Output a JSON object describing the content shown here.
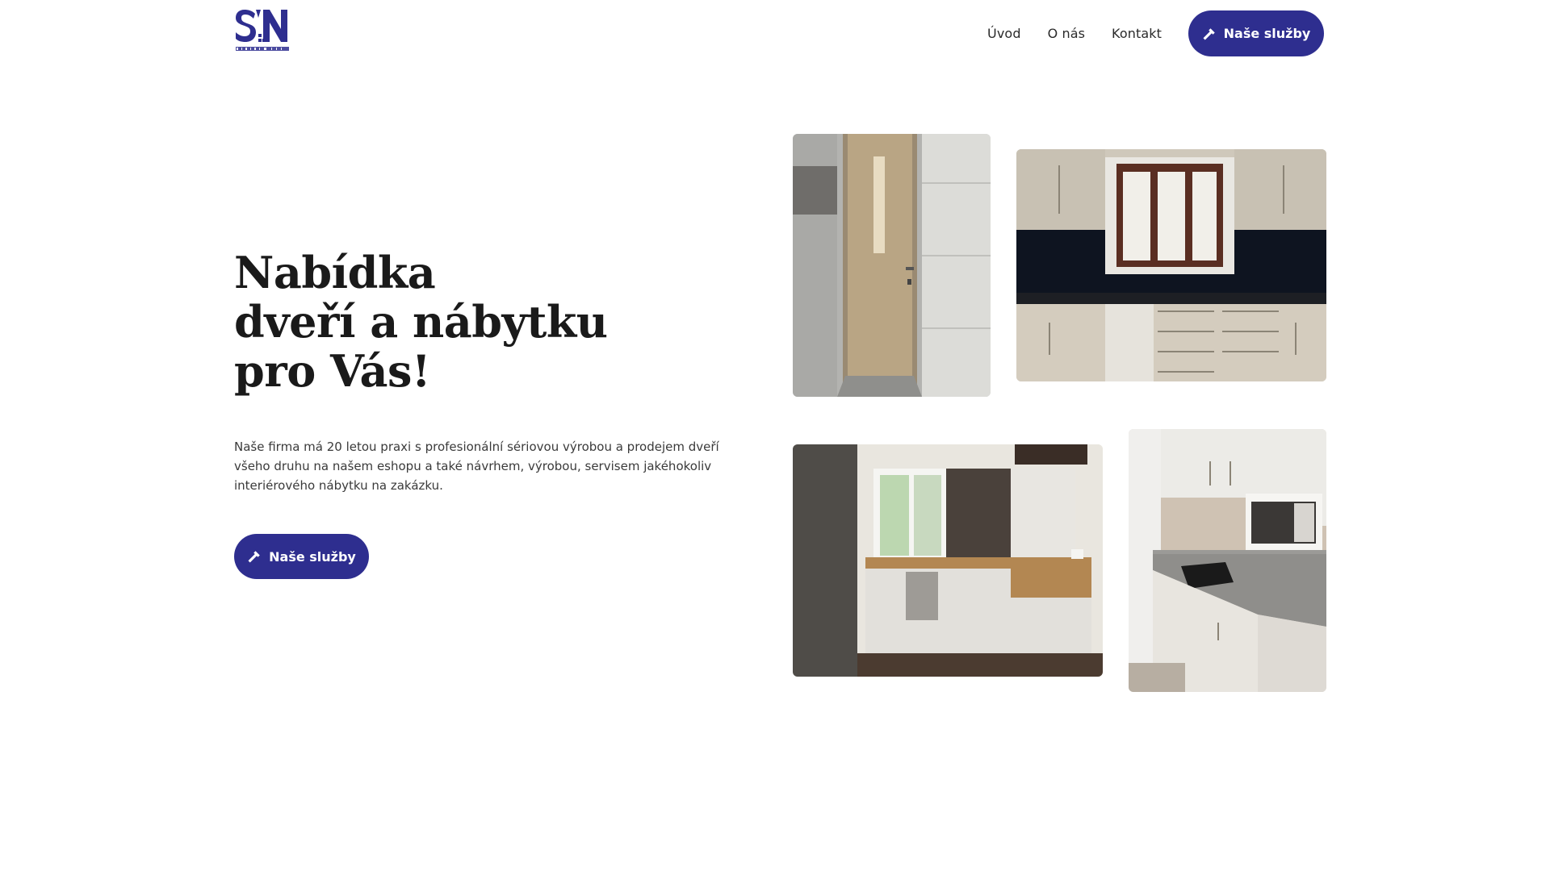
{
  "brand": {
    "logo_letters": "SN",
    "logo_subtitle": "MIRADE s.r.o.",
    "color": "#2e2e8f"
  },
  "nav": {
    "items": [
      {
        "label": "Úvod"
      },
      {
        "label": "O nás"
      },
      {
        "label": "Kontakt"
      }
    ],
    "cta_label": "Naše služby",
    "cta_icon": "hammer-icon"
  },
  "hero": {
    "title_lines": [
      "Nabídka",
      "dveří a nábytku",
      "pro Vás!"
    ],
    "description": "Naše firma má 20 letou praxi s profesionální sériovou výrobou a prodejem dveří všeho druhu na našem eshopu a také návrhem, výrobou, servisem jakéhokoliv interiérového nábytku na zakázku.",
    "cta_label": "Naše služby",
    "cta_icon": "hammer-icon"
  },
  "gallery": [
    {
      "subject": "wooden door in tiled bathroom"
    },
    {
      "subject": "kitchen with window and dark backsplash"
    },
    {
      "subject": "L-shaped kitchen with wooden countertop"
    },
    {
      "subject": "white kitchen with microwave shelf"
    }
  ]
}
